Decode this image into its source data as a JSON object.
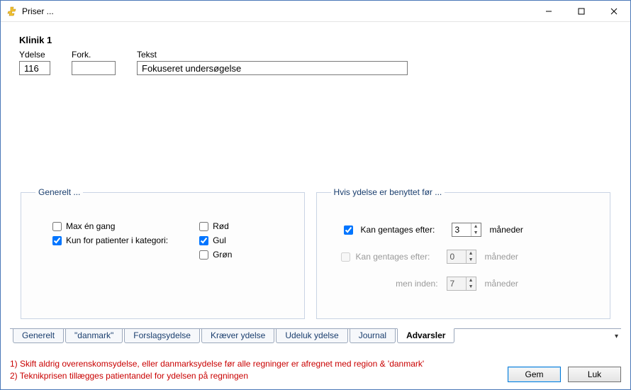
{
  "window": {
    "title": "Priser ..."
  },
  "header": {
    "clinic_title": "Klinik 1",
    "labels": {
      "ydelse": "Ydelse",
      "fork": "Fork.",
      "tekst": "Tekst"
    },
    "values": {
      "ydelse": "116",
      "fork": "",
      "tekst": "Fokuseret undersøgelse"
    }
  },
  "general_box": {
    "legend": "Generelt ...",
    "max_once": {
      "label": "Max én gang",
      "checked": false
    },
    "only_category": {
      "label": "Kun for patienter i kategori:",
      "checked": true
    },
    "categories": {
      "red": {
        "label": "Rød",
        "checked": false
      },
      "yellow": {
        "label": "Gul",
        "checked": true
      },
      "green": {
        "label": "Grøn",
        "checked": false
      }
    }
  },
  "repeat_box": {
    "legend": "Hvis ydelse er benyttet før ...",
    "line1": {
      "label": "Kan gentages efter:",
      "checked": true,
      "value": "3",
      "unit": "måneder"
    },
    "line2": {
      "label": "Kan gentages efter:",
      "checked": false,
      "value": "0",
      "unit": "måneder",
      "disabled": true
    },
    "line3": {
      "label": "men inden:",
      "value": "7",
      "unit": "måneder",
      "disabled": true
    }
  },
  "tabs": {
    "items": [
      {
        "label": "Generelt"
      },
      {
        "label": "\"danmark\""
      },
      {
        "label": "Forslagsydelse"
      },
      {
        "label": "Kræver ydelse"
      },
      {
        "label": "Udeluk ydelse"
      },
      {
        "label": "Journal"
      },
      {
        "label": "Advarsler"
      }
    ],
    "active_index": 6
  },
  "warnings": {
    "line1": "1) Skift aldrig overenskomsydelse, eller danmarksydelse før alle regninger er afregnet med region & 'danmark'",
    "line2": "2) Teknikprisen tillægges patientandel for ydelsen på regningen"
  },
  "buttons": {
    "save": "Gem",
    "close": "Luk"
  }
}
